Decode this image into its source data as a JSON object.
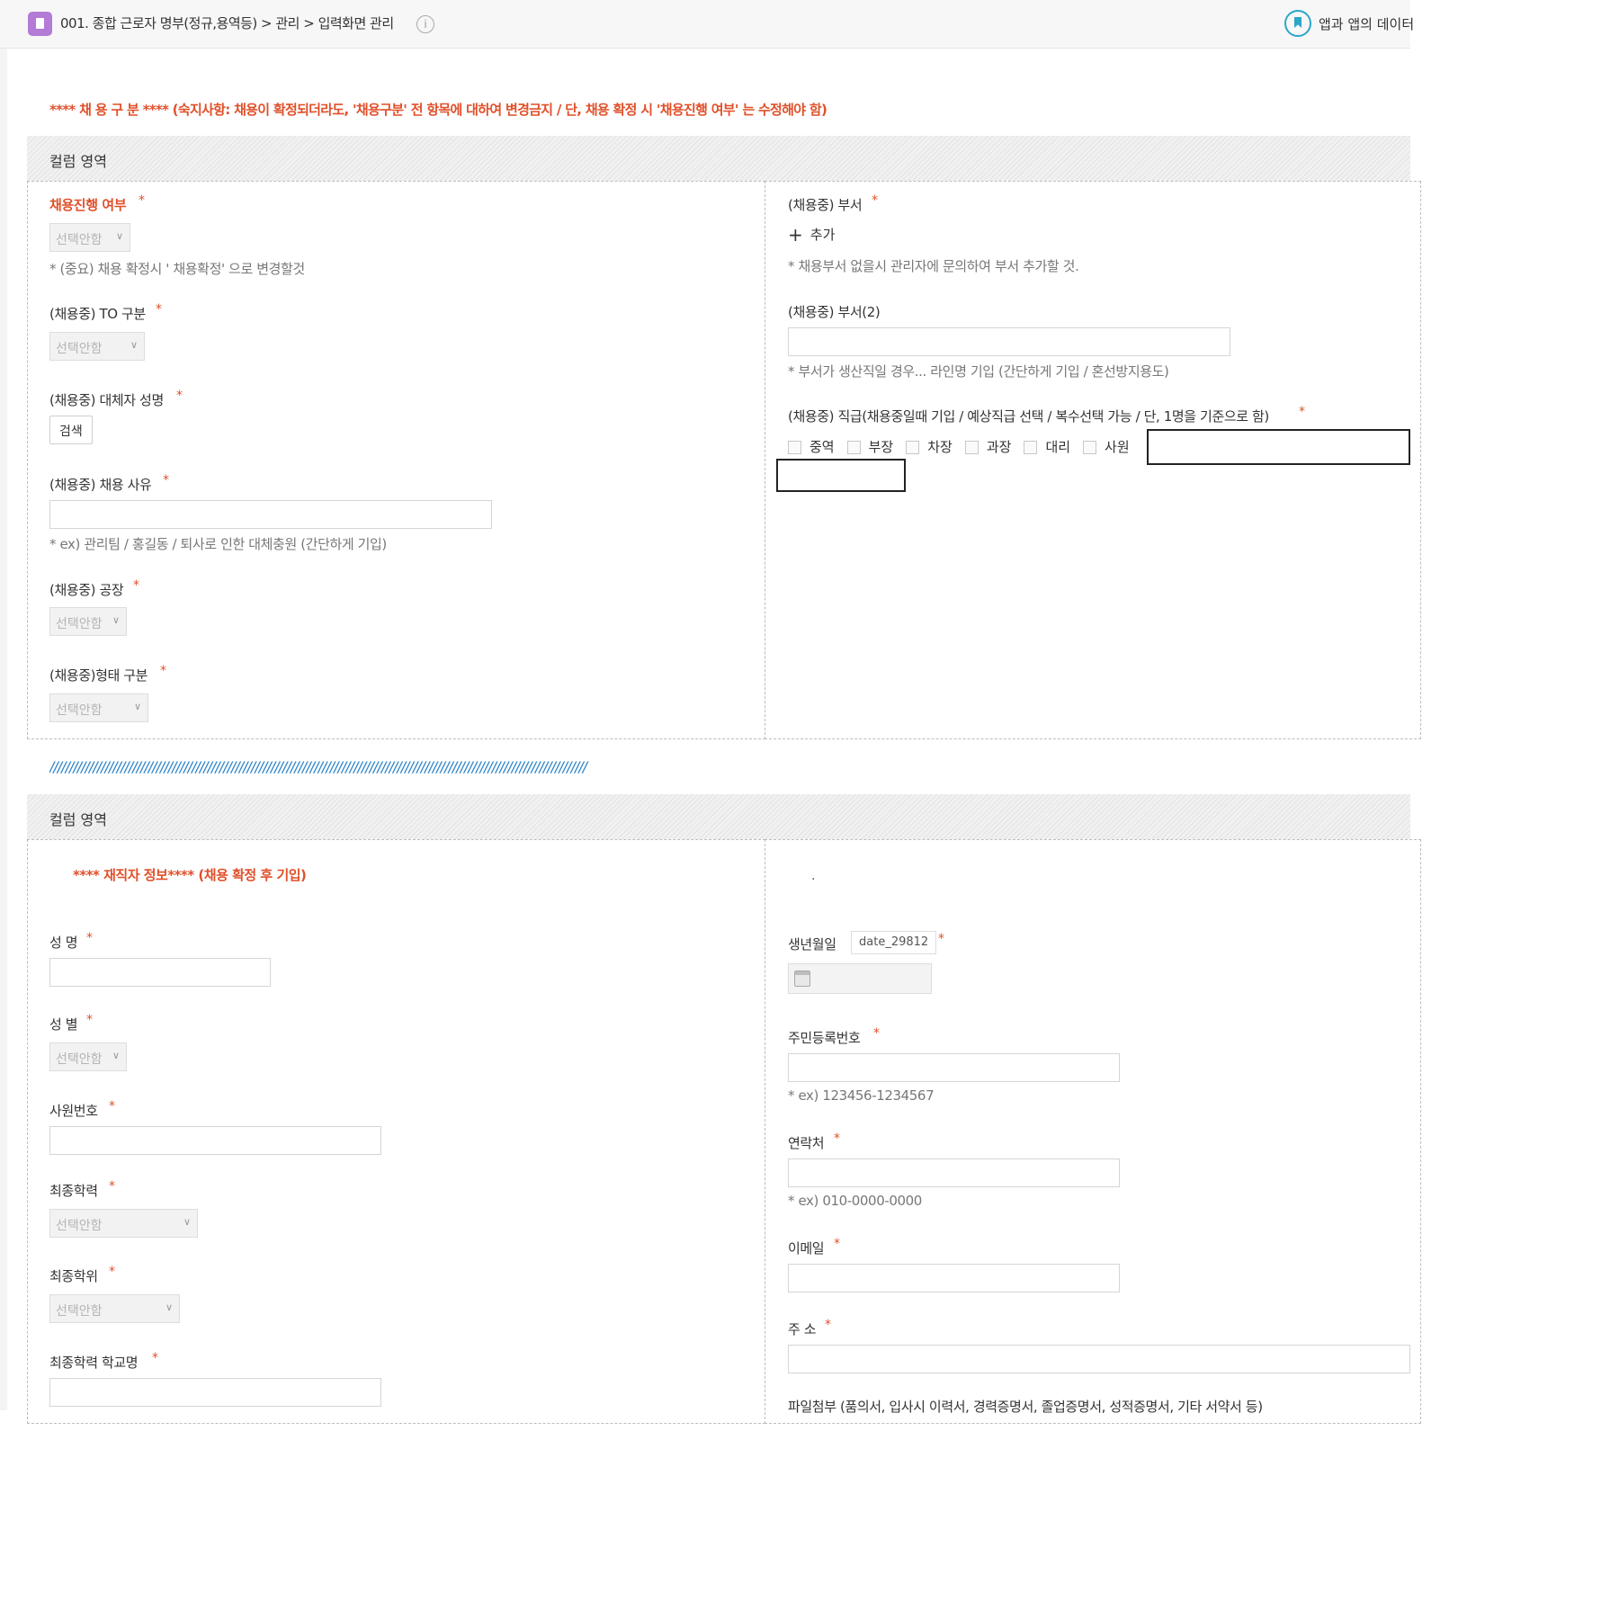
{
  "topbar": {
    "breadcrumb": "001. 종합 근로자 명부(정규,용역등) > 관리 > 입력화면 관리",
    "info": "i",
    "right_text": "앱과 앱의 데이터"
  },
  "notice": "**** 채 용 구 분 **** (숙지사항:    채용이 확정되더라도, '채용구분' 전 항목에 대하여 변경금지   /   단, 채용 확정 시 '채용진행 여부' 는 수정해야 함)",
  "section1": {
    "header": "컬럼 영역",
    "left": {
      "progress_label": "채용진행 여부",
      "progress_select": "선택안함",
      "progress_hint": "* (중요) 채용 확정시 ' 채용확정' 으로 변경할것",
      "to_label": "(채용중) TO 구분",
      "to_select": "선택안함",
      "replacement_label": "(채용중) 대체자 성명",
      "search_button": "검색",
      "reason_label": "(채용중) 채용 사유",
      "reason_hint": "* ex) 관리팀 / 홍길동 / 퇴사로 인한 대체충원 (간단하게 기입)",
      "factory_label": "(채용중) 공장",
      "factory_select": "선택안함",
      "type_label": "(채용중)형태 구분",
      "type_select": "선택안함"
    },
    "right": {
      "dept_label": "(채용중) 부서",
      "add_label": "추가",
      "dept_hint": "* 채용부서 없을시 관리자에 문의하여 부서 추가할 것.",
      "dept2_label": "(채용중) 부서(2)",
      "dept2_hint": "* 부서가 생산직일 경우... 라인명 기입 (간단하게 기입 / 혼선방지용도)",
      "rank_label": "(채용중) 직급(채용중일때 기입 / 예상직급 선택 / 복수선택 가능 / 단, 1명을 기준으로 함)",
      "ranks": [
        "중역",
        "부장",
        "차장",
        "과장",
        "대리",
        "사원"
      ]
    }
  },
  "divider": "////////////////////////////////////////////////////////////////////////////////////////////////////////////////////////////////////////",
  "section2": {
    "header": "컬럼 영역",
    "left": {
      "notice": "**** 재직자 정보**** (채용 확정 후 기입)",
      "name_label": "성 명",
      "gender_label": "성 별",
      "gender_select": "선택안함",
      "emp_no_label": "사원번호",
      "edu_label": "최종학력",
      "edu_select": "선택안함",
      "degree_label": "최종학위",
      "degree_select": "선택안함",
      "school_label": "최종학력 학교명"
    },
    "right": {
      "dot": ".",
      "birth_label": "생년월일",
      "birth_tag": "date_29812",
      "rrn_label": "주민등록번호",
      "rrn_hint": "* ex) 123456-1234567",
      "phone_label": "연락처",
      "phone_hint": "* ex) 010-0000-0000",
      "email_label": "이메일",
      "address_label": "주 소",
      "attach_label": "파일첨부 (품의서, 입사시 이력서, 경력증명서, 졸업증명서, 성적증명서, 기타 서약서 등)"
    }
  },
  "required_mark": "*",
  "colors": {
    "accent_red": "#e0502a",
    "accent_blue": "#2aa7c9"
  }
}
